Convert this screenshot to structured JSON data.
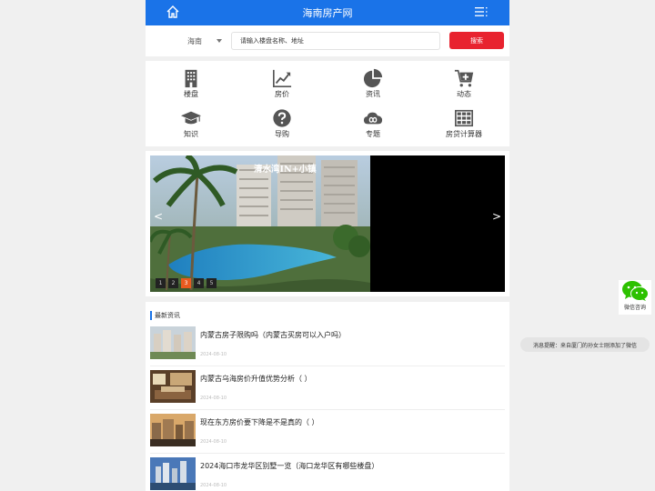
{
  "header": {
    "title": "海南房产网",
    "home_icon": "home-icon",
    "menu_icon": "menu-icon",
    "bg_color": "#1a73e8"
  },
  "search": {
    "city": "海南",
    "placeholder": "请输入楼盘名称、地址",
    "button_label": "搜索",
    "button_color": "#e8232f"
  },
  "nav": {
    "items": [
      {
        "label": "楼盘",
        "icon": "building-icon"
      },
      {
        "label": "房价",
        "icon": "trend-chart-icon"
      },
      {
        "label": "资讯",
        "icon": "pie-chart-icon"
      },
      {
        "label": "动态",
        "icon": "cart-plus-icon"
      },
      {
        "label": "知识",
        "icon": "graduation-cap-icon"
      },
      {
        "label": "导购",
        "icon": "question-icon"
      },
      {
        "label": "专题",
        "icon": "cloud-icon"
      },
      {
        "label": "房贷计算器",
        "icon": "calculator-grid-icon"
      }
    ]
  },
  "banner": {
    "caption": "清水湾IN+小镇",
    "prev": "<",
    "next": ">",
    "pages": [
      "1",
      "2",
      "3",
      "4",
      "5"
    ],
    "active_page": 3
  },
  "news": {
    "heading": "最新资讯",
    "items": [
      {
        "title": "内蒙古房子限购吗（内蒙古买房可以入户吗）",
        "date": "2024-08-10"
      },
      {
        "title": "内蒙古乌海房价升值优势分析（ ）",
        "date": "2024-08-10"
      },
      {
        "title": "现在东方房价要下降是不是真的（ ）",
        "date": "2024-08-10"
      },
      {
        "title": "2024海口市龙华区别墅一览（海口龙华区有哪些楼盘）",
        "date": "2024-08-10"
      }
    ]
  },
  "wechat": {
    "label": "微信咨询",
    "icon": "wechat-icon"
  },
  "notice": {
    "text": "消息提醒：来自厦门的孙女士刚添加了微信"
  }
}
